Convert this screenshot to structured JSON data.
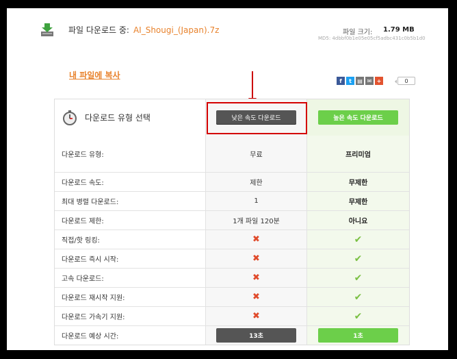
{
  "header": {
    "title_label": "파일 다운로드 중:",
    "file_name": "AI_Shougi_(Japan).7z",
    "size_label": "파일 크기:",
    "size_value": "1.79 MB",
    "md5": "MD5: 4dbbf0b1e05e05cf5adbc431c0b5b1d0"
  },
  "copy_link": "내 파일에 복사",
  "share": {
    "icons": [
      "facebook-icon",
      "twitter-icon",
      "print-icon",
      "email-icon",
      "plus-icon"
    ],
    "count": "0"
  },
  "table": {
    "header_label": "다운로드 유형 선택",
    "slow_button": "낮은 속도 다운로드",
    "fast_button": "높은 속도 다운로드",
    "rows": [
      {
        "label": "다운로드 유형:",
        "slow": "무료",
        "fast": "프리미엄"
      },
      {
        "label": "다운로드 속도:",
        "slow": "제한",
        "fast": "무제한"
      },
      {
        "label": "최대 병렬 다운로드:",
        "slow": "1",
        "fast": "무제한"
      },
      {
        "label": "다운로드 제한:",
        "slow": "1개 파일 120분",
        "fast": "아니요"
      },
      {
        "label": "직접/핫 링킹:",
        "slow": "✖",
        "fast": "✔"
      },
      {
        "label": "다운로드 즉시 시작:",
        "slow": "✖",
        "fast": "✔"
      },
      {
        "label": "고속 다운로드:",
        "slow": "✖",
        "fast": "✔"
      },
      {
        "label": "다운로드 재시작 지원:",
        "slow": "✖",
        "fast": "✔"
      },
      {
        "label": "다운로드 가속기 지원:",
        "slow": "✖",
        "fast": "✔"
      }
    ],
    "time_row": {
      "label": "다운로드 예상 시간:",
      "slow": "13초",
      "fast": "1초"
    }
  },
  "colors": {
    "accent_orange": "#e8822c",
    "slow_gray": "#555555",
    "fast_green": "#6ccf4a",
    "highlight_red": "#d40000"
  }
}
